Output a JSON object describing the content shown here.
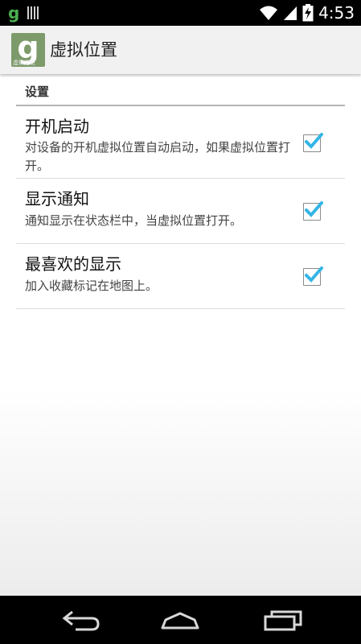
{
  "status_bar": {
    "time": "4:53",
    "left_icons": [
      "g-app-icon",
      "barcode-icon"
    ],
    "right_icons": [
      "wifi-icon",
      "signal-icon",
      "battery-charging-icon"
    ]
  },
  "app_bar": {
    "title": "虚拟位置",
    "icon_letter": "g",
    "icon_caption": "虚拟定位"
  },
  "settings": {
    "section_title": "设置",
    "items": [
      {
        "title": "开机启动",
        "summary": "对设备的开机虚拟位置自动启动，如果虚拟位置打开。",
        "checked": true
      },
      {
        "title": "显示通知",
        "summary": "通知显示在状态栏中，当虚拟位置打开。",
        "checked": true
      },
      {
        "title": "最喜欢的显示",
        "summary": "加入收藏标记在地图上。",
        "checked": true
      }
    ]
  },
  "colors": {
    "check_accent": "#33b5e5",
    "status_bar": "#000000",
    "action_bar": "#f1f1f1",
    "nav_bar": "#000000"
  },
  "navigation": {
    "buttons": [
      "back-icon",
      "home-icon",
      "recent-apps-icon"
    ]
  }
}
